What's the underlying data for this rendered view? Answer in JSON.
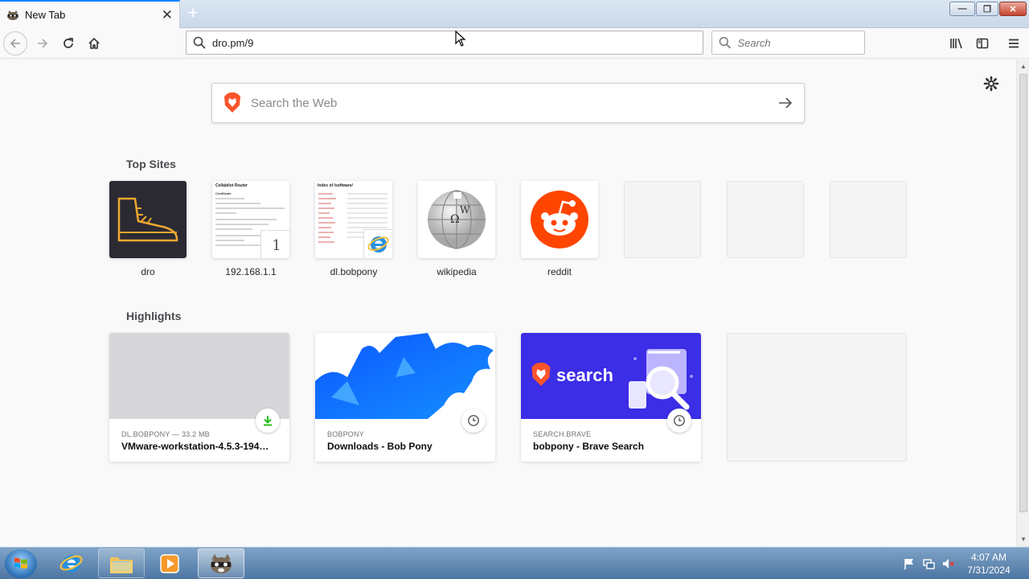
{
  "browser": {
    "tab": {
      "title": "New Tab",
      "close": "✕"
    },
    "newtab": "+",
    "window_controls": {
      "minimize": "—",
      "maximize": "❐",
      "close": "✕"
    },
    "url": "dro.pm/9",
    "search_placeholder": "Search"
  },
  "newtab_page": {
    "websearch_placeholder": "Search the Web",
    "top_sites_title": "Top Sites",
    "top_sites": [
      {
        "label": "dro"
      },
      {
        "label": "192.168.1.1",
        "badge": "1"
      },
      {
        "label": "dl.bobpony"
      },
      {
        "label": "wikipedia"
      },
      {
        "label": "reddit"
      }
    ],
    "highlights_title": "Highlights",
    "highlights": [
      {
        "host": "DL.BOBPONY — 33.2 MB",
        "title": "VMware-workstation-4.5.3-194…",
        "badge": "download-icon"
      },
      {
        "host": "BOBPONY",
        "title": "Downloads - Bob Pony",
        "badge": "clock-icon"
      },
      {
        "host": "SEARCH.BRAVE",
        "title": "bobpony - Brave Search",
        "badge": "clock-icon",
        "brand_text": "search"
      }
    ],
    "thumb_texts": {
      "router_title": "Cellabilot Router",
      "router_cert": "Certificate",
      "index_title": "Index of /software/"
    }
  },
  "taskbar": {
    "clock_time": "4:07 AM",
    "clock_date": "7/31/2024"
  },
  "colors": {
    "accent": "#0a84ff",
    "brave": "#fb542b",
    "reddit": "#ff4500",
    "brave_search_bg": "#3c2de6",
    "download_green": "#12bc00"
  }
}
